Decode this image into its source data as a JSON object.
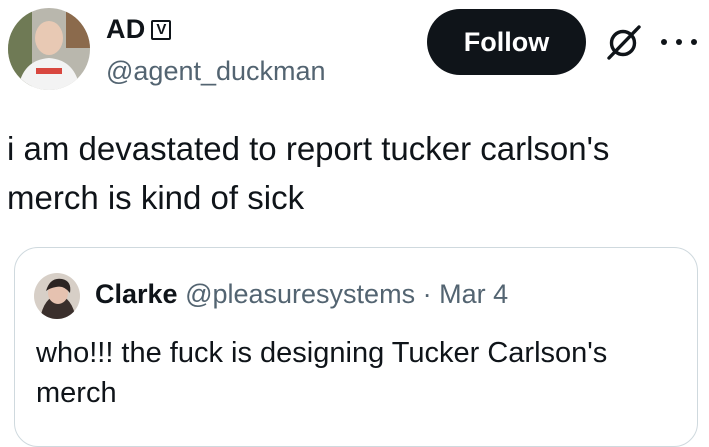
{
  "author": {
    "display_name": "AD",
    "badge": "V",
    "handle": "@agent_duckman"
  },
  "actions": {
    "follow_label": "Follow",
    "grok_icon": "grok-icon",
    "more_icon": "more-icon"
  },
  "tweet": {
    "text": "i am devastated to report tucker carlson's merch is kind of sick"
  },
  "quote": {
    "name": "Clarke",
    "handle": "@pleasuresystems",
    "separator": "·",
    "date": "Mar 4",
    "text": "who!!! the fuck is designing Tucker Carlson's merch"
  }
}
